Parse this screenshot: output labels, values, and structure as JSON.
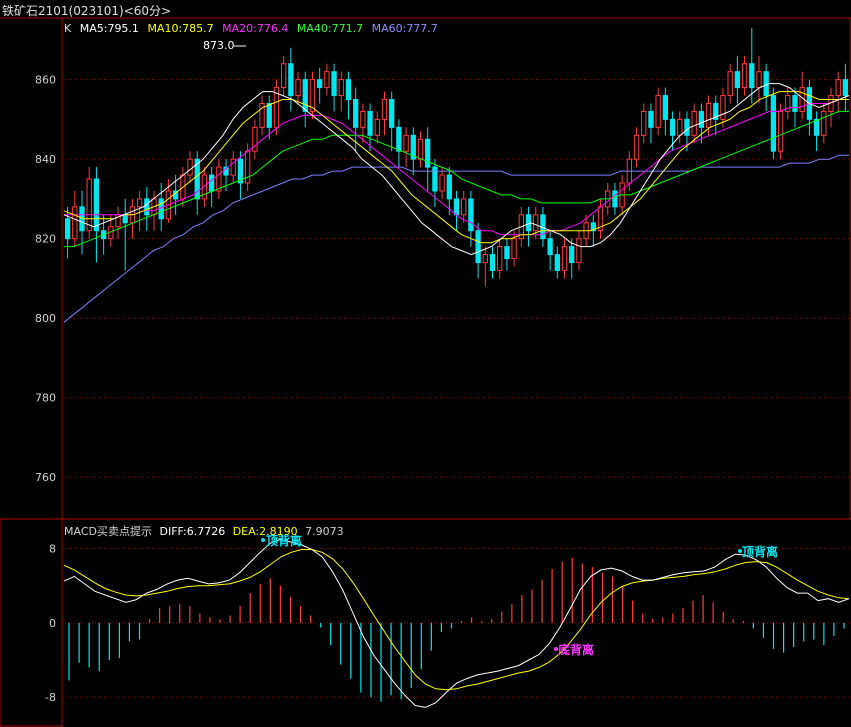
{
  "window": {
    "title": "铁矿石2101(023101)<60分>"
  },
  "main_legend": {
    "k_label": "K",
    "items": [
      {
        "label": "MA5:795.1",
        "color": "#ffffff"
      },
      {
        "label": "MA10:785.7",
        "color": "#ffff00"
      },
      {
        "label": "MA20:776.4",
        "color": "#ff00ff"
      },
      {
        "label": "MA40:771.7",
        "color": "#00ff00"
      },
      {
        "label": "MA60:777.7",
        "color": "#8080ff"
      }
    ]
  },
  "macd_legend": {
    "title": "MACD买卖点提示",
    "diff": "DIFF:6.7726",
    "dea": "DEA:2.8190",
    "macd": "7.9073"
  },
  "annotations": {
    "high_price": "873.0",
    "top_div_1": "顶背离",
    "top_div_2": "顶背离",
    "bottom_div": "底背离"
  },
  "colors": {
    "up": "#ff3b3b",
    "down": "#00e5ee",
    "grid": "#8b0000",
    "ma5": "#ffffff",
    "ma10": "#ffff00",
    "ma20": "#ff00ff",
    "ma40": "#00ff00",
    "ma60": "#8080ff"
  },
  "chart_data": [
    {
      "type": "candlestick",
      "ylim": [
        750,
        875
      ],
      "yticks": [
        "860",
        "840",
        "820",
        "800",
        "780",
        "760"
      ],
      "candles": [
        [
          825,
          820,
          828,
          815
        ],
        [
          820,
          828,
          832,
          818
        ],
        [
          828,
          822,
          832,
          816
        ],
        [
          822,
          835,
          838,
          820
        ],
        [
          835,
          822,
          838,
          814
        ],
        [
          822,
          820,
          826,
          816
        ],
        [
          820,
          823,
          826,
          818
        ],
        [
          823,
          826,
          828,
          820
        ],
        [
          826,
          824,
          830,
          812
        ],
        [
          824,
          828,
          830,
          820
        ],
        [
          828,
          830,
          832,
          822
        ],
        [
          830,
          826,
          833,
          822
        ],
        [
          826,
          830,
          832,
          822
        ],
        [
          830,
          825,
          834,
          822
        ],
        [
          825,
          832,
          835,
          824
        ],
        [
          832,
          830,
          836,
          826
        ],
        [
          830,
          836,
          838,
          828
        ],
        [
          836,
          840,
          842,
          834
        ],
        [
          840,
          830,
          842,
          826
        ],
        [
          830,
          836,
          838,
          828
        ],
        [
          836,
          832,
          838,
          828
        ],
        [
          832,
          838,
          840,
          830
        ],
        [
          838,
          836,
          840,
          832
        ],
        [
          836,
          840,
          842,
          834
        ],
        [
          840,
          834,
          842,
          830
        ],
        [
          834,
          842,
          844,
          832
        ],
        [
          842,
          848,
          850,
          840
        ],
        [
          848,
          854,
          856,
          846
        ],
        [
          854,
          848,
          856,
          845
        ],
        [
          848,
          858,
          860,
          846
        ],
        [
          858,
          864,
          866,
          856
        ],
        [
          864,
          856,
          868,
          852
        ],
        [
          856,
          860,
          862,
          854
        ],
        [
          860,
          852,
          862,
          848
        ],
        [
          852,
          860,
          862,
          850
        ],
        [
          860,
          858,
          863,
          854
        ],
        [
          858,
          862,
          864,
          856
        ],
        [
          862,
          856,
          864,
          852
        ],
        [
          856,
          860,
          862,
          852
        ],
        [
          860,
          855,
          862,
          850
        ],
        [
          855,
          848,
          858,
          842
        ],
        [
          848,
          852,
          854,
          844
        ],
        [
          852,
          846,
          854,
          842
        ],
        [
          846,
          850,
          852,
          844
        ],
        [
          850,
          855,
          857,
          846
        ],
        [
          855,
          848,
          857,
          842
        ],
        [
          848,
          842,
          850,
          838
        ],
        [
          842,
          846,
          848,
          838
        ],
        [
          846,
          840,
          848,
          836
        ],
        [
          840,
          845,
          847,
          838
        ],
        [
          845,
          838,
          848,
          832
        ],
        [
          838,
          832,
          840,
          828
        ],
        [
          832,
          836,
          838,
          830
        ],
        [
          836,
          830,
          838,
          826
        ],
        [
          830,
          826,
          832,
          822
        ],
        [
          826,
          830,
          832,
          824
        ],
        [
          830,
          822,
          832,
          818
        ],
        [
          822,
          814,
          824,
          810
        ],
        [
          814,
          816,
          818,
          808
        ],
        [
          816,
          812,
          818,
          810
        ],
        [
          812,
          818,
          820,
          810
        ],
        [
          818,
          815,
          820,
          812
        ],
        [
          815,
          820,
          822,
          813
        ],
        [
          820,
          826,
          828,
          818
        ],
        [
          826,
          822,
          828,
          818
        ],
        [
          822,
          826,
          828,
          820
        ],
        [
          826,
          820,
          828,
          818
        ],
        [
          820,
          816,
          822,
          812
        ],
        [
          816,
          812,
          818,
          810
        ],
        [
          812,
          818,
          820,
          810
        ],
        [
          818,
          814,
          820,
          810
        ],
        [
          814,
          820,
          822,
          812
        ],
        [
          820,
          824,
          826,
          818
        ],
        [
          824,
          822,
          826,
          818
        ],
        [
          822,
          828,
          830,
          820
        ],
        [
          828,
          832,
          834,
          826
        ],
        [
          832,
          828,
          834,
          826
        ],
        [
          828,
          834,
          836,
          826
        ],
        [
          834,
          840,
          842,
          832
        ],
        [
          840,
          846,
          848,
          838
        ],
        [
          846,
          852,
          854,
          844
        ],
        [
          852,
          848,
          854,
          844
        ],
        [
          848,
          856,
          858,
          846
        ],
        [
          856,
          850,
          858,
          846
        ],
        [
          850,
          846,
          852,
          842
        ],
        [
          846,
          850,
          852,
          844
        ],
        [
          850,
          846,
          852,
          842
        ],
        [
          846,
          852,
          854,
          844
        ],
        [
          852,
          848,
          854,
          844
        ],
        [
          848,
          854,
          856,
          846
        ],
        [
          854,
          850,
          856,
          846
        ],
        [
          850,
          856,
          858,
          848
        ],
        [
          856,
          862,
          864,
          854
        ],
        [
          862,
          858,
          866,
          854
        ],
        [
          858,
          864,
          866,
          856
        ],
        [
          864,
          858,
          873,
          854
        ],
        [
          858,
          862,
          866,
          854
        ],
        [
          862,
          856,
          864,
          852
        ],
        [
          856,
          842,
          858,
          840
        ],
        [
          842,
          852,
          854,
          840
        ],
        [
          852,
          856,
          858,
          850
        ],
        [
          856,
          852,
          858,
          848
        ],
        [
          852,
          858,
          862,
          850
        ],
        [
          858,
          850,
          860,
          846
        ],
        [
          850,
          846,
          852,
          842
        ],
        [
          846,
          852,
          854,
          844
        ],
        [
          852,
          856,
          858,
          848
        ],
        [
          856,
          860,
          862,
          852
        ],
        [
          860,
          856,
          864,
          852
        ]
      ],
      "ma5": [
        826,
        825,
        824,
        823,
        824,
        825,
        826,
        827,
        828,
        830,
        832,
        834,
        836,
        838,
        840,
        843,
        846,
        850,
        853,
        855,
        857,
        857,
        856,
        855,
        853,
        851,
        849,
        847,
        845,
        843,
        840,
        838,
        836,
        833,
        830,
        827,
        824,
        822,
        820,
        818,
        817,
        816,
        817,
        818,
        820,
        822,
        823,
        824,
        823,
        822,
        821,
        819,
        818,
        818,
        819,
        821,
        824,
        828,
        832,
        836,
        840,
        843,
        846,
        848,
        849,
        850,
        851,
        852,
        854,
        856,
        858,
        859,
        859,
        858,
        856,
        854,
        853,
        854,
        855,
        856
      ],
      "ma10": [
        827,
        826,
        825,
        825,
        825,
        825,
        826,
        826,
        827,
        828,
        829,
        831,
        833,
        835,
        837,
        840,
        843,
        846,
        849,
        851,
        853,
        854,
        855,
        855,
        854,
        853,
        851,
        849,
        847,
        845,
        843,
        841,
        839,
        837,
        834,
        831,
        829,
        827,
        825,
        823,
        821,
        820,
        819,
        819,
        820,
        820,
        821,
        821,
        822,
        822,
        822,
        822,
        822,
        822,
        823,
        824,
        826,
        828,
        830,
        833,
        836,
        839,
        842,
        844,
        846,
        848,
        849,
        850,
        852,
        853,
        855,
        856,
        857,
        857,
        857,
        856,
        855,
        855,
        855,
        855
      ],
      "ma20": [
        826,
        826,
        826,
        826,
        826,
        826,
        826,
        826,
        827,
        827,
        828,
        829,
        830,
        831,
        833,
        835,
        837,
        839,
        841,
        843,
        845,
        847,
        849,
        850,
        851,
        851,
        851,
        850,
        849,
        847,
        845,
        843,
        841,
        839,
        837,
        835,
        833,
        831,
        829,
        827,
        825,
        824,
        822,
        822,
        821,
        821,
        821,
        821,
        821,
        822,
        822,
        823,
        824,
        826,
        828,
        830,
        832,
        834,
        836,
        838,
        840,
        842,
        843,
        844,
        845,
        846,
        847,
        848,
        849,
        850,
        851,
        852,
        852,
        853,
        853,
        854,
        854,
        854,
        855,
        855
      ],
      "ma40": [
        818,
        818,
        819,
        820,
        821,
        822,
        823,
        824,
        825,
        826,
        827,
        828,
        829,
        830,
        831,
        832,
        833,
        834,
        835,
        836,
        838,
        840,
        842,
        843,
        844,
        845,
        845,
        846,
        846,
        846,
        846,
        845,
        844,
        843,
        842,
        841,
        840,
        839,
        838,
        837,
        835,
        834,
        833,
        832,
        831,
        831,
        830,
        830,
        829,
        829,
        829,
        829,
        829,
        829,
        830,
        830,
        831,
        831,
        832,
        833,
        834,
        835,
        836,
        837,
        838,
        839,
        840,
        841,
        842,
        843,
        844,
        845,
        846,
        847,
        848,
        849,
        850,
        851,
        852,
        852
      ],
      "ma60": [
        799,
        801,
        803,
        805,
        807,
        809,
        811,
        813,
        815,
        817,
        818,
        820,
        821,
        823,
        824,
        826,
        827,
        829,
        830,
        831,
        832,
        833,
        834,
        835,
        835,
        836,
        836,
        837,
        837,
        838,
        838,
        838,
        838,
        838,
        838,
        837,
        837,
        837,
        837,
        837,
        837,
        837,
        837,
        837,
        837,
        836,
        836,
        836,
        836,
        836,
        836,
        836,
        836,
        836,
        836,
        836,
        837,
        837,
        837,
        837,
        837,
        837,
        837,
        837,
        838,
        838,
        838,
        838,
        838,
        838,
        838,
        838,
        838,
        839,
        839,
        839,
        840,
        840,
        841,
        841
      ]
    },
    {
      "type": "macd",
      "ylim": [
        -11,
        10
      ],
      "yticks": [
        "8",
        "0",
        "-8"
      ],
      "diff": [
        4.5,
        5.0,
        4.2,
        3.4,
        3.0,
        2.6,
        2.2,
        2.5,
        3.2,
        3.6,
        4.2,
        4.6,
        4.8,
        4.5,
        4.2,
        4.3,
        4.6,
        5.4,
        6.5,
        7.6,
        8.6,
        9.0,
        8.7,
        8.4,
        7.9,
        7.1,
        5.5,
        3.5,
        1.0,
        -1.5,
        -3.5,
        -5.0,
        -6.5,
        -7.8,
        -8.9,
        -9.1,
        -8.6,
        -7.5,
        -6.5,
        -6.0,
        -5.6,
        -5.4,
        -5.2,
        -4.9,
        -4.6,
        -4.0,
        -3.4,
        -2.2,
        -0.5,
        1.5,
        3.6,
        5.0,
        5.7,
        5.9,
        5.6,
        5.0,
        4.6,
        4.6,
        4.9,
        5.2,
        5.4,
        5.5,
        5.6,
        6.0,
        6.8,
        7.4,
        7.3,
        6.8,
        6.0,
        4.8,
        3.8,
        3.2,
        3.2,
        2.4,
        2.6,
        2.2,
        2.6
      ],
      "dea": [
        6.2,
        5.7,
        5.0,
        4.3,
        3.7,
        3.3,
        3.0,
        2.9,
        3.0,
        3.2,
        3.4,
        3.7,
        3.9,
        4.0,
        4.0,
        4.1,
        4.2,
        4.5,
        4.9,
        5.5,
        6.3,
        7.1,
        7.6,
        7.9,
        7.9,
        7.6,
        6.9,
        5.8,
        4.3,
        2.6,
        0.8,
        -0.9,
        -2.6,
        -4.1,
        -5.6,
        -6.6,
        -7.1,
        -7.2,
        -7.1,
        -6.8,
        -6.6,
        -6.3,
        -6.0,
        -5.7,
        -5.4,
        -5.2,
        -4.8,
        -4.2,
        -3.3,
        -2.1,
        -0.7,
        0.9,
        2.2,
        3.2,
        3.9,
        4.3,
        4.5,
        4.6,
        4.8,
        4.9,
        5.0,
        5.2,
        5.3,
        5.5,
        5.8,
        6.2,
        6.5,
        6.6,
        6.5,
        6.0,
        5.3,
        4.6,
        4.0,
        3.4,
        3.0,
        2.7,
        2.6
      ],
      "hist": [
        -6.2,
        -4.3,
        -4.8,
        -5.2,
        -4.0,
        -3.8,
        -2.0,
        -1.8,
        0.4,
        1.6,
        1.8,
        2.0,
        1.8,
        1.0,
        0.6,
        0.4,
        0.8,
        1.8,
        3.2,
        4.2,
        4.8,
        4.0,
        2.8,
        1.8,
        0.8,
        -0.5,
        -2.4,
        -4.5,
        -6.0,
        -7.5,
        -8.0,
        -8.5,
        -7.8,
        -8.2,
        -7.0,
        -5.0,
        -3.0,
        -1.0,
        -0.6,
        0.2,
        0.6,
        0.2,
        0.4,
        1.2,
        2.0,
        3.0,
        3.6,
        4.6,
        5.8,
        6.6,
        7.0,
        6.4,
        6.0,
        5.4,
        5.0,
        4.0,
        2.4,
        1.0,
        0.4,
        0.6,
        1.0,
        1.6,
        2.4,
        3.0,
        2.2,
        1.2,
        0.4,
        0.2,
        -0.6,
        -1.6,
        -2.8,
        -3.2,
        -2.6,
        -2.0,
        -1.8,
        -2.4,
        -1.4,
        -0.6
      ]
    }
  ]
}
